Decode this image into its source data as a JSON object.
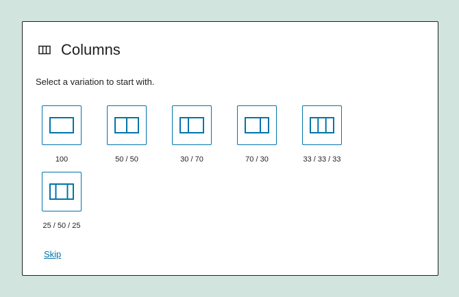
{
  "block": {
    "title": "Columns",
    "icon": "columns-icon",
    "instructions": "Select a variation to start with."
  },
  "variations": [
    {
      "label": "100",
      "icon": "one-column-icon"
    },
    {
      "label": "50 / 50",
      "icon": "two-columns-equal-icon"
    },
    {
      "label": "30 / 70",
      "icon": "two-columns-30-70-icon"
    },
    {
      "label": "70 / 30",
      "icon": "two-columns-70-30-icon"
    },
    {
      "label": "33 / 33 / 33",
      "icon": "three-columns-equal-icon"
    },
    {
      "label": "25 / 50 / 25",
      "icon": "three-columns-wide-center-icon"
    }
  ],
  "skip_label": "Skip",
  "colors": {
    "accent": "#0073aa",
    "background": "#d1e4dd",
    "panel": "#ffffff",
    "text": "#1e1e1e"
  }
}
